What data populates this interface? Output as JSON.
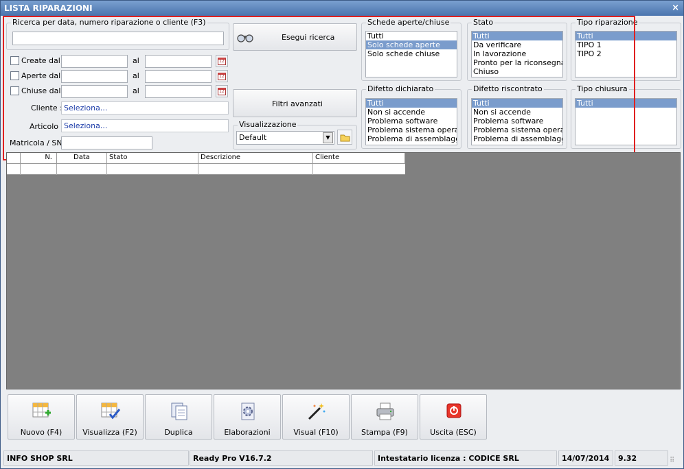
{
  "window": {
    "title": "LISTA RIPARAZIONI",
    "close": "×"
  },
  "search": {
    "legend": "Ricerca per data, numero riparazione o cliente (F3)",
    "value": ""
  },
  "dates": {
    "created_label": "Create dal",
    "opened_label": "Aperte dal",
    "closed_label": "Chiuse dal",
    "al": "al",
    "cal_glyph": "12"
  },
  "cliente": {
    "label": "Cliente :",
    "value": "Seleziona..."
  },
  "articolo": {
    "label": "Articolo :",
    "value": "Seleziona..."
  },
  "matricola": {
    "label": "Matricola / SN:",
    "value": ""
  },
  "buttons": {
    "search": "Esegui ricerca",
    "advanced": "Filtri avanzati"
  },
  "visualizzazione": {
    "legend": "Visualizzazione",
    "selected": "Default"
  },
  "schede": {
    "legend": "Schede aperte/chiuse",
    "items": [
      "Tutti",
      "Solo schede aperte",
      "Solo schede chiuse"
    ],
    "selected": 1
  },
  "stato": {
    "legend": "Stato",
    "items": [
      "Tutti",
      "Da verificare",
      "In lavorazione",
      "Pronto per la riconsegna",
      "Chiuso"
    ],
    "selected": 0
  },
  "tipo_riparazione": {
    "legend": "Tipo riparazione",
    "items": [
      "Tutti",
      "TIPO 1",
      "TIPO 2"
    ],
    "selected": 0
  },
  "difetto_dichiarato": {
    "legend": "Difetto dichiarato",
    "items": [
      "Tutti",
      "Non si accende",
      "Problema software",
      "Problema sistema operativo",
      "Problema di assemblaggio"
    ],
    "selected": 0
  },
  "difetto_riscontrato": {
    "legend": "Difetto riscontrato",
    "items": [
      "Tutti",
      "Non si accende",
      "Problema software",
      "Problema sistema operativo",
      "Problema di assemblaggio"
    ],
    "selected": 0
  },
  "tipo_chiusura": {
    "legend": "Tipo chiusura",
    "items": [
      "Tutti"
    ],
    "selected": 0
  },
  "table": {
    "columns": [
      "N.",
      "Data",
      "Stato",
      "Descrizione",
      "Cliente"
    ]
  },
  "toolbar": {
    "nuovo": "Nuovo (F4)",
    "visualizza": "Visualizza (F2)",
    "duplica": "Duplica",
    "elaborazioni": "Elaborazioni",
    "visual": "Visual (F10)",
    "stampa": "Stampa (F9)",
    "uscita": "Uscita (ESC)"
  },
  "status": {
    "company": "INFO SHOP SRL",
    "version": "Ready Pro V16.7.2",
    "license": "Intestatario licenza : CODICE SRL",
    "date": "14/07/2014",
    "time": "9.32"
  },
  "colors": {
    "highlight": "#e02020",
    "selection": "#7a9ccc",
    "title_bar": "#4a74ad",
    "grid_bg": "#808080"
  }
}
